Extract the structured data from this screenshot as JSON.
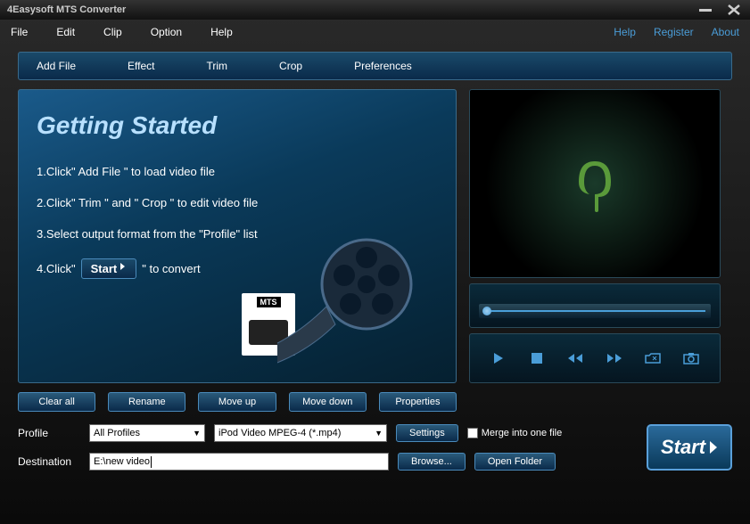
{
  "titlebar": {
    "title": "4Easysoft MTS Converter"
  },
  "menubar": {
    "left": [
      "File",
      "Edit",
      "Clip",
      "Option",
      "Help"
    ],
    "right": [
      "Help",
      "Register",
      "About"
    ]
  },
  "toolbar": [
    "Add File",
    "Effect",
    "Trim",
    "Crop",
    "Preferences"
  ],
  "getting_started": {
    "title": "Getting Started",
    "step1": "1.Click\" Add File \" to load video file",
    "step2": "2.Click\" Trim \" and \" Crop \" to edit video file",
    "step3": "3.Select output format from the \"Profile\" list",
    "step4_prefix": "4.Click\"",
    "step4_btn": "Start",
    "step4_suffix": "\" to convert",
    "mts_label": "MTS"
  },
  "file_buttons": [
    "Clear all",
    "Rename",
    "Move up",
    "Move down",
    "Properties"
  ],
  "form": {
    "profile_label": "Profile",
    "profile_all": "All Profiles",
    "profile_format": "iPod Video MPEG-4 (*.mp4)",
    "settings_label": "Settings",
    "merge_label": "Merge into one file",
    "destination_label": "Destination",
    "destination_value": "E:\\new video",
    "browse_label": "Browse...",
    "open_folder_label": "Open Folder"
  },
  "start_button": "Start"
}
